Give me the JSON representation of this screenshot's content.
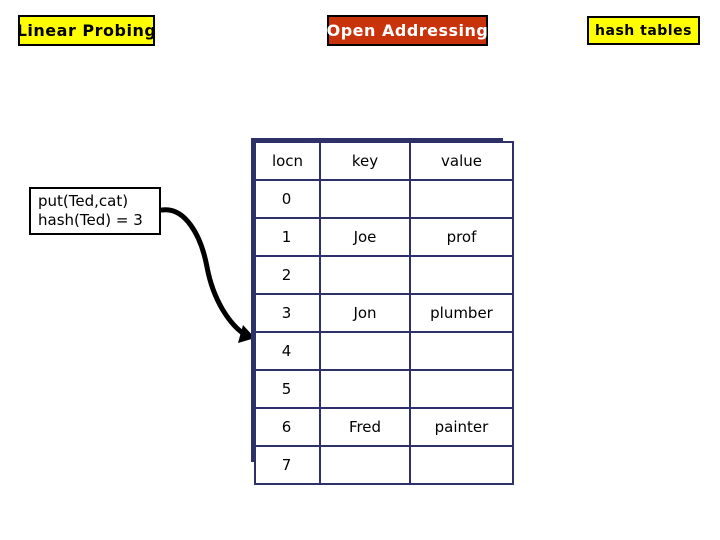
{
  "slide": {
    "background_color": "#ffffff",
    "chips": [
      {
        "id": "linear-probing",
        "label": "Linear Probing",
        "bg_color": "#ffff00",
        "text_color": "#000000",
        "border_color": "#000000"
      },
      {
        "id": "open-addressing",
        "label": "Open Addressing",
        "bg_color": "#c8330c",
        "text_color": "#ffffff",
        "border_color": "#000000"
      },
      {
        "id": "hash-tables",
        "label": "hash tables",
        "bg_color": "#ffff00",
        "text_color": "#000000",
        "border_color": "#000000"
      }
    ]
  },
  "callout": {
    "line1": "put(Ted,cat)",
    "line2": "hash(Ted) = 3",
    "bg_color": "#ffffff",
    "border_color": "#000000",
    "text_color": "#000000"
  },
  "arrow": {
    "name": "curved-pointer-arrow",
    "color": "#000000",
    "points_to_row_locn": "4"
  },
  "hash_table": {
    "border_color": "#2e3068",
    "text_color": "#000000",
    "bg_color": "#ffffff",
    "columns": [
      "locn",
      "key",
      "value"
    ],
    "rows": [
      {
        "locn": "0",
        "key": "",
        "value": ""
      },
      {
        "locn": "1",
        "key": "Joe",
        "value": "prof"
      },
      {
        "locn": "2",
        "key": "",
        "value": ""
      },
      {
        "locn": "3",
        "key": "Jon",
        "value": "plumber"
      },
      {
        "locn": "4",
        "key": "",
        "value": ""
      },
      {
        "locn": "5",
        "key": "",
        "value": ""
      },
      {
        "locn": "6",
        "key": "Fred",
        "value": "painter"
      },
      {
        "locn": "7",
        "key": "",
        "value": ""
      }
    ]
  }
}
